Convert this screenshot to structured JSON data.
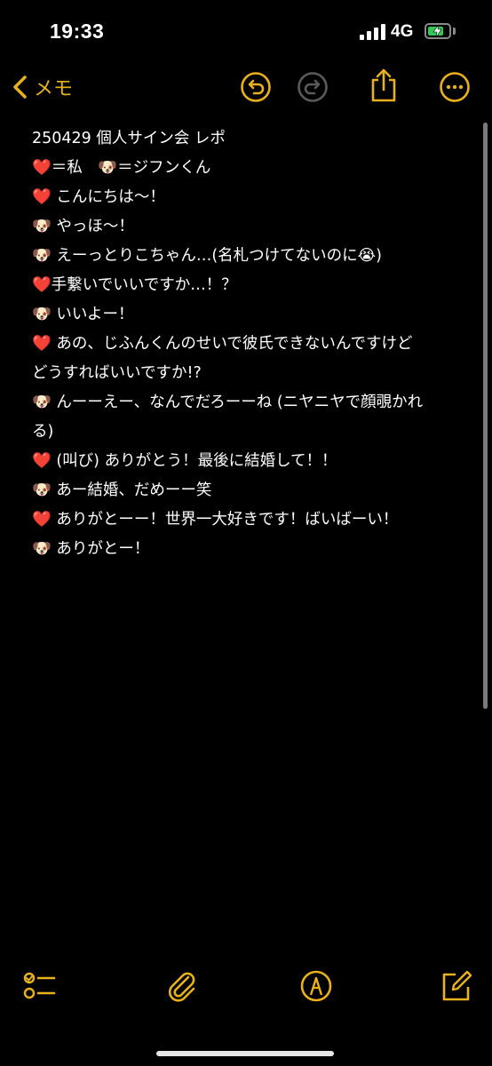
{
  "status": {
    "time": "19:33",
    "network": "4G",
    "battery_level": 0.75
  },
  "nav": {
    "back_label": "メモ"
  },
  "note": {
    "lines": [
      "250429 個人サイン会 レポ",
      "❤️＝私　🐶＝ジフンくん",
      "",
      "",
      "❤️ こんにちは～！",
      "",
      "🐶 やっほ～！",
      "",
      "🐶 えーっとりこちゃん…(名札つけてないのに😭)",
      "",
      "❤️手繋いでいいですか…！？",
      "",
      "🐶 いいよー！",
      "",
      "❤️ あの、じふんくんのせいで彼氏できないんですけど",
      "どうすればいいですか!?",
      "",
      "🐶 んーーえー、なんでだろーーね (ニヤニヤで顔覗かれ",
      "る)",
      "",
      "❤️ (叫び) ありがとう！最後に結婚して！！",
      "",
      "🐶 あー結婚、だめーー笑",
      "",
      "❤️ ありがとーー！世界一大好きです！ばいばーい！",
      "",
      "🐶 ありがとー！"
    ]
  },
  "colors": {
    "accent": "#e8b21c",
    "battery": "#34c759",
    "background": "#000000"
  }
}
